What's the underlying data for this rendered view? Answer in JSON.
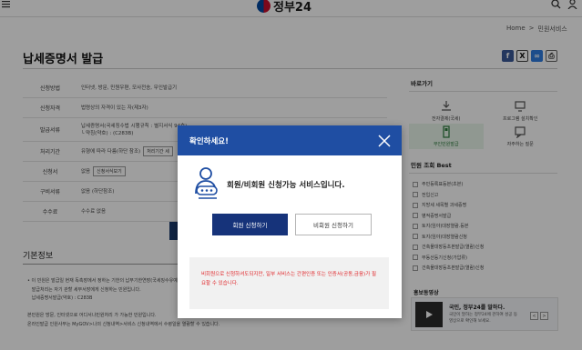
{
  "header": {
    "logo_text": "정부24",
    "icons": [
      "menu-icon",
      "search-icon",
      "user-icon"
    ]
  },
  "breadcrumb": {
    "home": "Home",
    "sep": ">",
    "current": "민원서비스"
  },
  "page": {
    "title": "납세증명서 발급",
    "share_icons": [
      "facebook-icon",
      "x-icon",
      "link-icon",
      "print-icon"
    ]
  },
  "info_rows": [
    {
      "label": "신청방법",
      "value": "인터넷, 방문, 민원우편, 모사전송, 무인발급기",
      "button": ""
    },
    {
      "label": "신청자격",
      "value": "법령상의 자격이 있는 자(제3자)",
      "button": ""
    },
    {
      "label": "발급서류",
      "value": "납세증명서(국세징수법 시행규칙 : 별지서식 94호)\n└ 약칭(약호) : (C283B)",
      "button": ""
    },
    {
      "label": "처리기간",
      "value": "유형에 따라 다름(하단 참조)",
      "button": "처리기간 세"
    },
    {
      "label": "신청서",
      "value": "없음",
      "button": "신청서식보기"
    },
    {
      "label": "구비서류",
      "value": "없음 (하단참조)",
      "button": ""
    },
    {
      "label": "수수료",
      "value": "수수료 없음",
      "button": ""
    }
  ],
  "basic_info": {
    "title": "기본정보",
    "lines": [
      "• 이 민원은 발급일 현재 독촉장에서 정하는 기한의 납부기한연장(국세징수유예)",
      "   발급처리는 자기 관할 세무서장에게 신청하는 민원입니다.",
      "   납세증명서발급(약호) : C283B",
      "",
      "본민원은 방문, 인터넷으로 어디서나민원처리 가 가능한 민원입니다.",
      "온라인발급 인원사무는 MyGOV>나의 신청내역>서비스 신청내역에서 수령일을 열람할 수 있습니다."
    ]
  },
  "sidebar": {
    "quick_title": "바로가기",
    "quick_items": [
      {
        "label": "전자결제(국세)",
        "icon": "download-icon",
        "active": false
      },
      {
        "label": "프로그램 설치확인",
        "icon": "monitor-icon",
        "active": false
      },
      {
        "label": "무인민원발급",
        "icon": "kiosk-icon",
        "active": true
      },
      {
        "label": "자주하는 질문",
        "icon": "faq-icon",
        "active": false
      }
    ],
    "best_title": "민원 조회 Best",
    "best_items": [
      "주민등록표등본(초본)",
      "전입신고",
      "지방세 세목별 과세증명",
      "병적증명서발급",
      "토지(임야)대장열람.등본",
      "토지(임야)대장열람신청",
      "건축물대장등초본발급(열람)신청",
      "부동산등기신청(가압류)",
      "건축물대장등초본발급(열람)신청"
    ],
    "promo_title": "홍보동영상",
    "promo_card_title": "국민, 정부24를 말하다.",
    "promo_card_text": "국민이 말하는 정부24에 관하여 성공 동영상으로 확인해 보세요.",
    "promo_prev": "<",
    "promo_next": ">"
  },
  "modal": {
    "title": "확인하세요!",
    "message": "회원/비회원 신청가능 서비스입니다.",
    "primary_button": "회원 신청하기",
    "secondary_button": "비회원 신청하기",
    "notice": "비회원으로 신청하셔도되지만, 일부 서비스는 간편인증 또는 인증서(공동,금융)가 필요할 수 있습니다.",
    "colors": {
      "header": "#1f4ea3",
      "primary": "#16337a",
      "notice_text": "#e0262a"
    }
  }
}
